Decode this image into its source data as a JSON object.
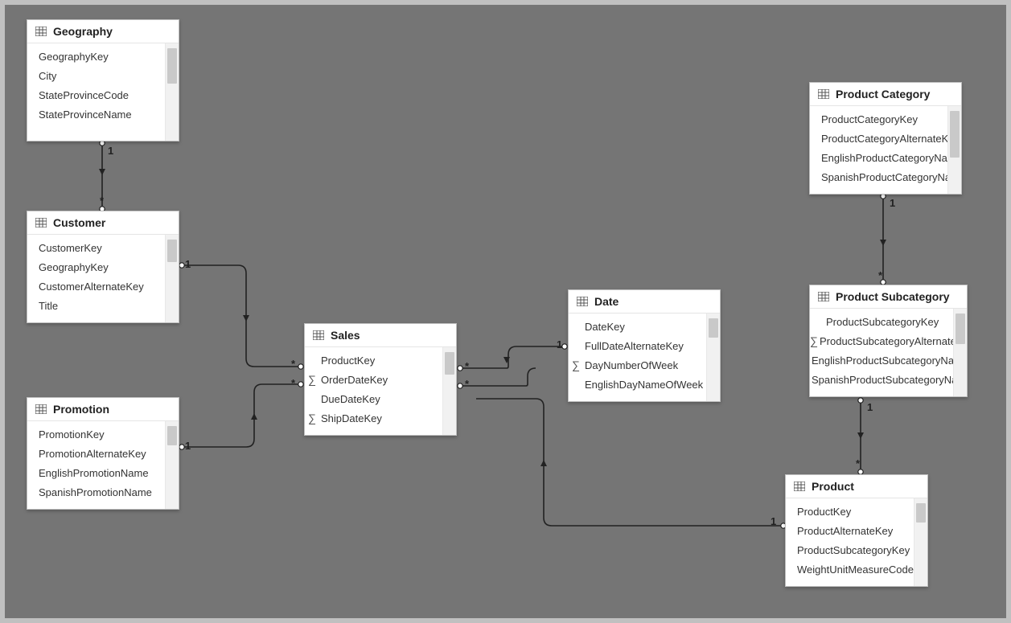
{
  "tables": {
    "geography": {
      "title": "Geography",
      "fields": [
        "GeographyKey",
        "City",
        "StateProvinceCode",
        "StateProvinceName"
      ]
    },
    "customer": {
      "title": "Customer",
      "fields": [
        "CustomerKey",
        "GeographyKey",
        "CustomerAlternateKey",
        "Title"
      ]
    },
    "promotion": {
      "title": "Promotion",
      "fields": [
        "PromotionKey",
        "PromotionAlternateKey",
        "EnglishPromotionName",
        "SpanishPromotionName"
      ]
    },
    "sales": {
      "title": "Sales",
      "fields": [
        "ProductKey",
        "OrderDateKey",
        "DueDateKey",
        "ShipDateKey"
      ],
      "measures": {
        "OrderDateKey": true,
        "ShipDateKey": true
      }
    },
    "date": {
      "title": "Date",
      "fields": [
        "DateKey",
        "FullDateAlternateKey",
        "DayNumberOfWeek",
        "EnglishDayNameOfWeek"
      ],
      "measures": {
        "DayNumberOfWeek": true
      }
    },
    "productCategory": {
      "title": "Product Category",
      "fields": [
        "ProductCategoryKey",
        "ProductCategoryAlternateKey",
        "EnglishProductCategoryName",
        "SpanishProductCategoryName"
      ]
    },
    "productSubcategory": {
      "title": "Product Subcategory",
      "fields": [
        "ProductSubcategoryKey",
        "ProductSubcategoryAlternateKey",
        "EnglishProductSubcategoryName",
        "SpanishProductSubcategoryName"
      ],
      "measures": {
        "ProductSubcategoryAlternateKey": true
      }
    },
    "product": {
      "title": "Product",
      "fields": [
        "ProductKey",
        "ProductAlternateKey",
        "ProductSubcategoryKey",
        "WeightUnitMeasureCode"
      ]
    }
  },
  "cardinality": {
    "one": "1",
    "many": "*"
  }
}
